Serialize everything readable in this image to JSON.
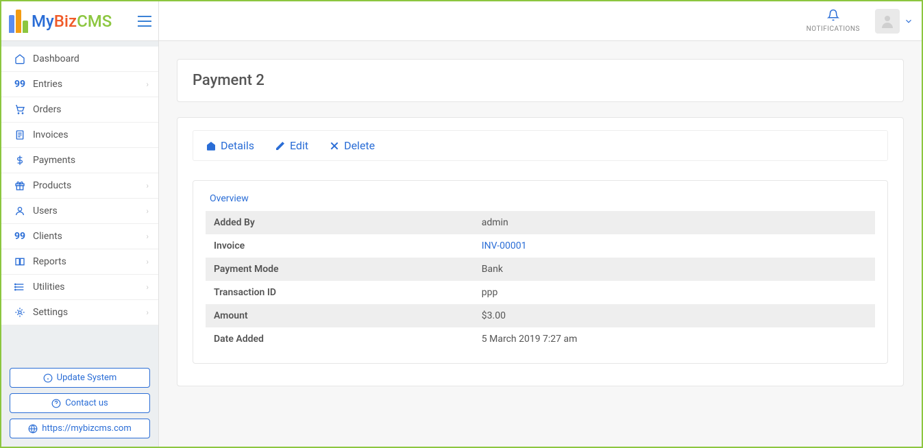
{
  "header": {
    "notifications_label": "NOTIFICATIONS"
  },
  "sidebar": {
    "items": [
      {
        "label": "Dashboard",
        "icon": "home",
        "expandable": false
      },
      {
        "label": "Entries",
        "icon": "99",
        "expandable": true
      },
      {
        "label": "Orders",
        "icon": "cart",
        "expandable": false
      },
      {
        "label": "Invoices",
        "icon": "doc",
        "expandable": false
      },
      {
        "label": "Payments",
        "icon": "dollar",
        "expandable": false
      },
      {
        "label": "Products",
        "icon": "gift",
        "expandable": true
      },
      {
        "label": "Users",
        "icon": "user",
        "expandable": true
      },
      {
        "label": "Clients",
        "icon": "99",
        "expandable": true
      },
      {
        "label": "Reports",
        "icon": "book",
        "expandable": true
      },
      {
        "label": "Utilities",
        "icon": "list",
        "expandable": true
      },
      {
        "label": "Settings",
        "icon": "gear",
        "expandable": true
      }
    ],
    "buttons": {
      "update": "Update System",
      "contact": "Contact us",
      "site": "https://mybizcms.com"
    }
  },
  "page": {
    "title": "Payment 2",
    "tabs": {
      "details": "Details",
      "edit": "Edit",
      "delete": "Delete"
    },
    "overview_label": "Overview",
    "rows": [
      {
        "key": "Added By",
        "val": "admin",
        "link": false
      },
      {
        "key": "Invoice",
        "val": "INV-00001",
        "link": true
      },
      {
        "key": "Payment Mode",
        "val": "Bank",
        "link": false
      },
      {
        "key": "Transaction ID",
        "val": "ppp",
        "link": false
      },
      {
        "key": "Amount",
        "val": "$3.00",
        "link": false
      },
      {
        "key": "Date Added",
        "val": "5 March 2019 7:27 am",
        "link": false
      }
    ]
  }
}
